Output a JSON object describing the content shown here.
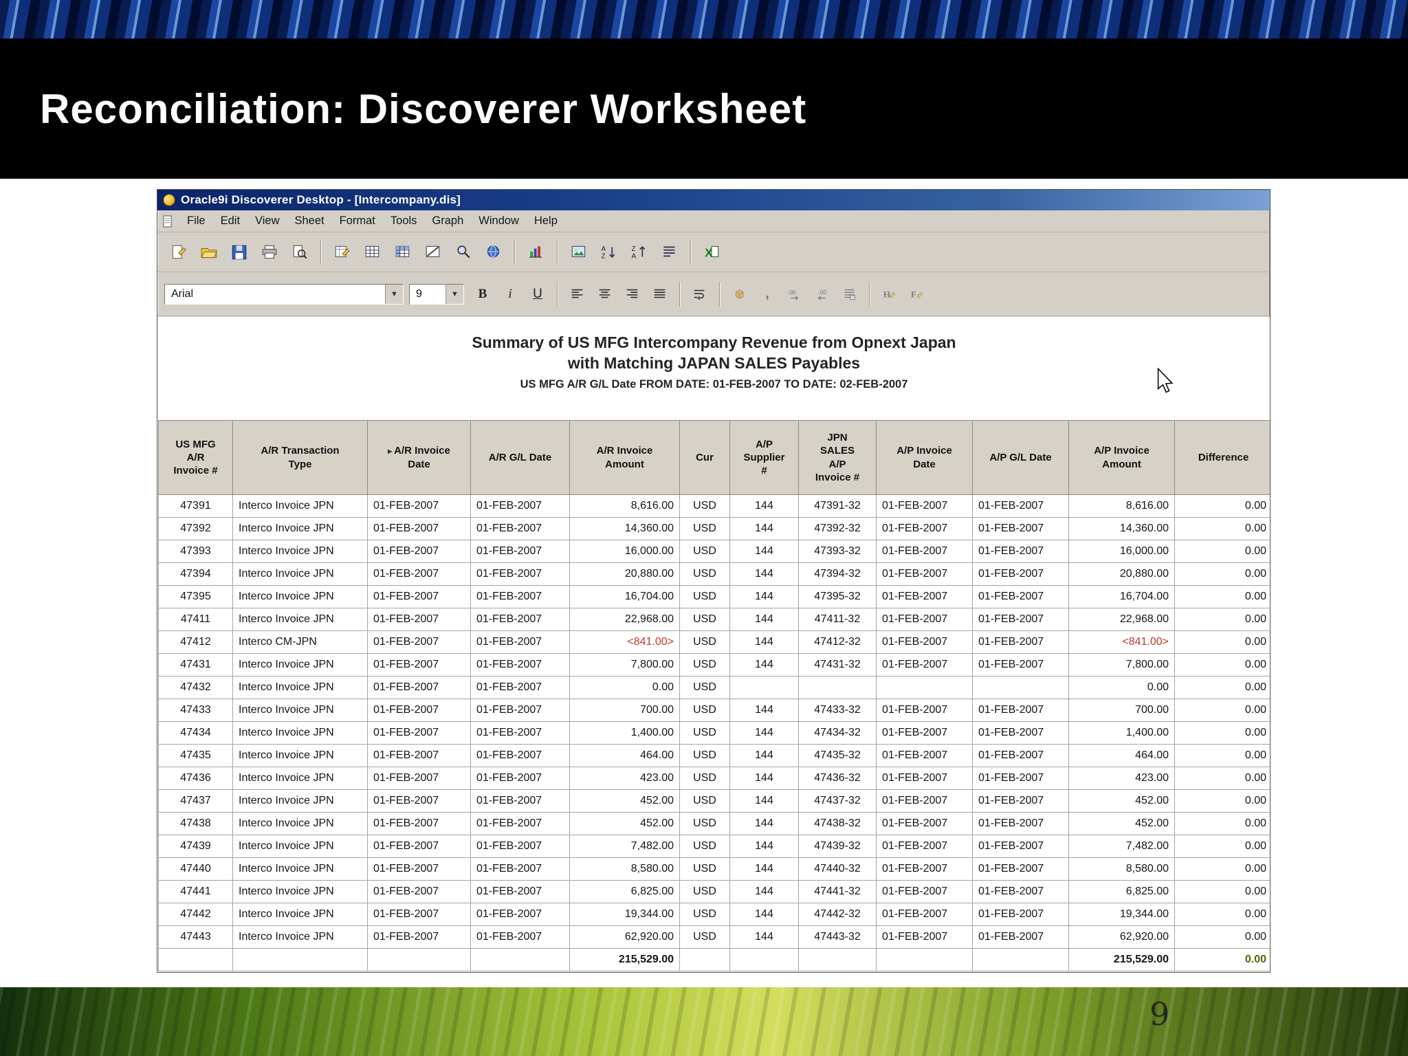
{
  "slide": {
    "title": "Reconciliation: Discoverer Worksheet",
    "page_number": "9"
  },
  "window": {
    "title": "Oracle9i Discoverer Desktop - [Intercompany.dis]",
    "menu_items": [
      "File",
      "Edit",
      "View",
      "Sheet",
      "Format",
      "Tools",
      "Graph",
      "Window",
      "Help"
    ],
    "standard_toolbar_groups": [
      [
        "new-sheet",
        "open",
        "save",
        "print",
        "print-preview"
      ],
      [
        "edit-sheet",
        "table-layout",
        "crosstab-layout",
        "edit-title",
        "zoom",
        "web-publish"
      ],
      [
        "graph"
      ],
      [
        "insert-image",
        "sort-ascending",
        "sort-descending",
        "format-columns"
      ],
      [
        "export-excel"
      ]
    ],
    "format_toolbar": {
      "font_name": "Arial",
      "font_size": "9",
      "button_groups": [
        [
          "bold",
          "italic",
          "underline"
        ],
        [
          "align-left",
          "align-center",
          "align-right",
          "align-justify"
        ],
        [
          "wrap-text"
        ],
        [
          "format-data",
          "thousands-separator",
          "increase-decimal",
          "decrease-decimal",
          "totals"
        ],
        [
          "header-edit",
          "footer-edit"
        ]
      ]
    }
  },
  "worksheet": {
    "title_line1": "Summary of US MFG Intercompany Revenue from Opnext Japan",
    "title_line2": "with Matching JAPAN SALES Payables",
    "title_line3": "US MFG A/R G/L Date FROM DATE: 01-FEB-2007    TO DATE: 02-FEB-2007"
  },
  "table": {
    "columns": [
      {
        "label": "US MFG\nA/R\nInvoice #"
      },
      {
        "label": "A/R Transaction\nType"
      },
      {
        "label": "A/R Invoice\nDate",
        "sort_icon": true
      },
      {
        "label": "A/R G/L Date"
      },
      {
        "label": "A/R Invoice\nAmount"
      },
      {
        "label": "Cur"
      },
      {
        "label": "A/P\nSupplier\n#"
      },
      {
        "label": "JPN\nSALES\nA/P\nInvoice #"
      },
      {
        "label": "A/P Invoice\nDate"
      },
      {
        "label": "A/P G/L Date"
      },
      {
        "label": "A/P Invoice\nAmount"
      },
      {
        "label": "Difference"
      }
    ],
    "rows": [
      [
        "47391",
        "Interco Invoice JPN",
        "01-FEB-2007",
        "01-FEB-2007",
        "8,616.00",
        "USD",
        "144",
        "47391-32",
        "01-FEB-2007",
        "01-FEB-2007",
        "8,616.00",
        "0.00"
      ],
      [
        "47392",
        "Interco Invoice JPN",
        "01-FEB-2007",
        "01-FEB-2007",
        "14,360.00",
        "USD",
        "144",
        "47392-32",
        "01-FEB-2007",
        "01-FEB-2007",
        "14,360.00",
        "0.00"
      ],
      [
        "47393",
        "Interco Invoice JPN",
        "01-FEB-2007",
        "01-FEB-2007",
        "16,000.00",
        "USD",
        "144",
        "47393-32",
        "01-FEB-2007",
        "01-FEB-2007",
        "16,000.00",
        "0.00"
      ],
      [
        "47394",
        "Interco Invoice JPN",
        "01-FEB-2007",
        "01-FEB-2007",
        "20,880.00",
        "USD",
        "144",
        "47394-32",
        "01-FEB-2007",
        "01-FEB-2007",
        "20,880.00",
        "0.00"
      ],
      [
        "47395",
        "Interco Invoice JPN",
        "01-FEB-2007",
        "01-FEB-2007",
        "16,704.00",
        "USD",
        "144",
        "47395-32",
        "01-FEB-2007",
        "01-FEB-2007",
        "16,704.00",
        "0.00"
      ],
      [
        "47411",
        "Interco Invoice JPN",
        "01-FEB-2007",
        "01-FEB-2007",
        "22,968.00",
        "USD",
        "144",
        "47411-32",
        "01-FEB-2007",
        "01-FEB-2007",
        "22,968.00",
        "0.00"
      ],
      [
        "47412",
        "Interco CM-JPN",
        "01-FEB-2007",
        "01-FEB-2007",
        "<841.00>",
        "USD",
        "144",
        "47412-32",
        "01-FEB-2007",
        "01-FEB-2007",
        "<841.00>",
        "0.00"
      ],
      [
        "47431",
        "Interco Invoice JPN",
        "01-FEB-2007",
        "01-FEB-2007",
        "7,800.00",
        "USD",
        "144",
        "47431-32",
        "01-FEB-2007",
        "01-FEB-2007",
        "7,800.00",
        "0.00"
      ],
      [
        "47432",
        "Interco Invoice JPN",
        "01-FEB-2007",
        "01-FEB-2007",
        "0.00",
        "USD",
        "",
        "",
        "",
        "",
        "0.00",
        "0.00"
      ],
      [
        "47433",
        "Interco Invoice JPN",
        "01-FEB-2007",
        "01-FEB-2007",
        "700.00",
        "USD",
        "144",
        "47433-32",
        "01-FEB-2007",
        "01-FEB-2007",
        "700.00",
        "0.00"
      ],
      [
        "47434",
        "Interco Invoice JPN",
        "01-FEB-2007",
        "01-FEB-2007",
        "1,400.00",
        "USD",
        "144",
        "47434-32",
        "01-FEB-2007",
        "01-FEB-2007",
        "1,400.00",
        "0.00"
      ],
      [
        "47435",
        "Interco Invoice JPN",
        "01-FEB-2007",
        "01-FEB-2007",
        "464.00",
        "USD",
        "144",
        "47435-32",
        "01-FEB-2007",
        "01-FEB-2007",
        "464.00",
        "0.00"
      ],
      [
        "47436",
        "Interco Invoice JPN",
        "01-FEB-2007",
        "01-FEB-2007",
        "423.00",
        "USD",
        "144",
        "47436-32",
        "01-FEB-2007",
        "01-FEB-2007",
        "423.00",
        "0.00"
      ],
      [
        "47437",
        "Interco Invoice JPN",
        "01-FEB-2007",
        "01-FEB-2007",
        "452.00",
        "USD",
        "144",
        "47437-32",
        "01-FEB-2007",
        "01-FEB-2007",
        "452.00",
        "0.00"
      ],
      [
        "47438",
        "Interco Invoice JPN",
        "01-FEB-2007",
        "01-FEB-2007",
        "452.00",
        "USD",
        "144",
        "47438-32",
        "01-FEB-2007",
        "01-FEB-2007",
        "452.00",
        "0.00"
      ],
      [
        "47439",
        "Interco Invoice JPN",
        "01-FEB-2007",
        "01-FEB-2007",
        "7,482.00",
        "USD",
        "144",
        "47439-32",
        "01-FEB-2007",
        "01-FEB-2007",
        "7,482.00",
        "0.00"
      ],
      [
        "47440",
        "Interco Invoice JPN",
        "01-FEB-2007",
        "01-FEB-2007",
        "8,580.00",
        "USD",
        "144",
        "47440-32",
        "01-FEB-2007",
        "01-FEB-2007",
        "8,580.00",
        "0.00"
      ],
      [
        "47441",
        "Interco Invoice JPN",
        "01-FEB-2007",
        "01-FEB-2007",
        "6,825.00",
        "USD",
        "144",
        "47441-32",
        "01-FEB-2007",
        "01-FEB-2007",
        "6,825.00",
        "0.00"
      ],
      [
        "47442",
        "Interco Invoice JPN",
        "01-FEB-2007",
        "01-FEB-2007",
        "19,344.00",
        "USD",
        "144",
        "47442-32",
        "01-FEB-2007",
        "01-FEB-2007",
        "19,344.00",
        "0.00"
      ],
      [
        "47443",
        "Interco Invoice JPN",
        "01-FEB-2007",
        "01-FEB-2007",
        "62,920.00",
        "USD",
        "144",
        "47443-32",
        "01-FEB-2007",
        "01-FEB-2007",
        "62,920.00",
        "0.00"
      ]
    ],
    "total_row": [
      "",
      "",
      "",
      "",
      "215,529.00",
      "",
      "",
      "",
      "",
      "",
      "215,529.00",
      "0.00"
    ]
  }
}
